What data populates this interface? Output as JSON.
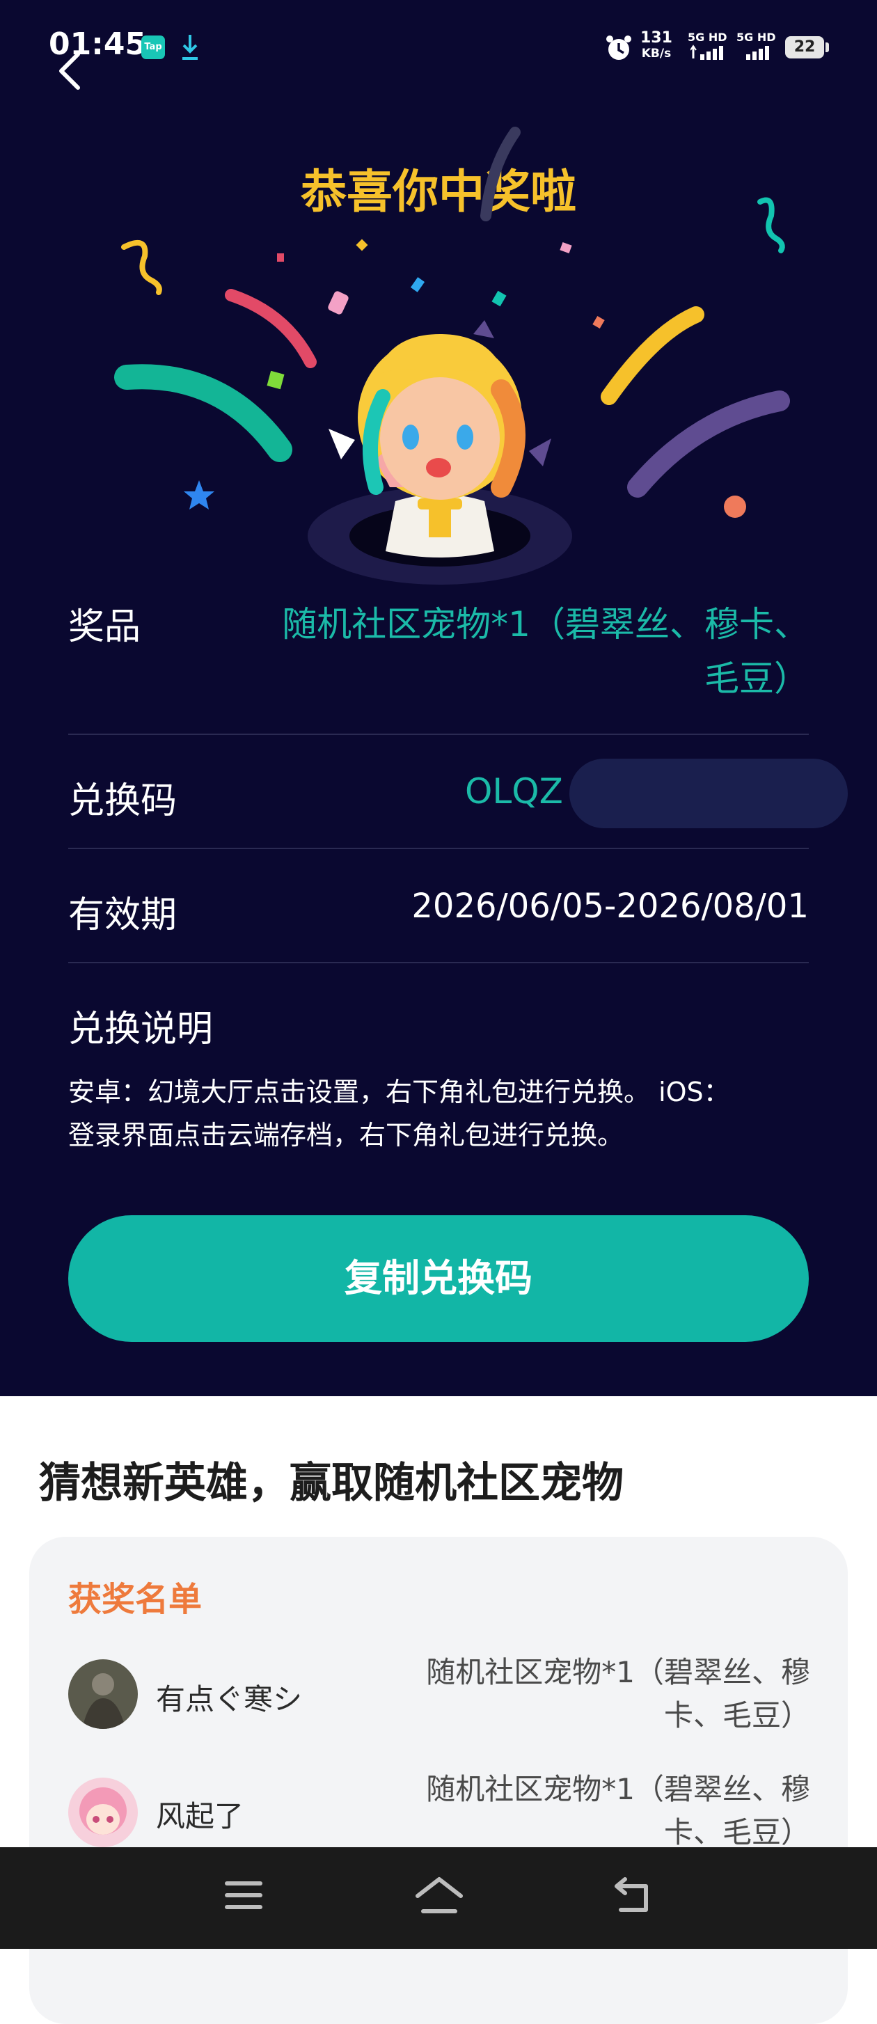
{
  "status_bar": {
    "time": "01:45",
    "tap_label": "Tap",
    "net_speed_value": "131",
    "net_speed_unit": "KB/s",
    "sim1": "5G HD",
    "sim2": "5G HD",
    "battery": "22"
  },
  "header": {
    "title": "恭喜你中奖啦"
  },
  "prize": {
    "label": "奖品",
    "value_line1": "随机社区宠物*1（碧翠丝、穆卡、",
    "value_line2": "毛豆）"
  },
  "code": {
    "label": "兑换码",
    "value": "OLQZ"
  },
  "validity": {
    "label": "有效期",
    "value": "2026/06/05-2026/08/01"
  },
  "instructions": {
    "label": "兑换说明",
    "line1": "安卓：幻境大厅点击设置，右下角礼包进行兑换。 iOS：",
    "line2": "登录界面点击云端存档，右下角礼包进行兑换。"
  },
  "copy_button": "复制兑换码",
  "section": {
    "title": "猜想新英雄，赢取随机社区宠物"
  },
  "winners": {
    "title": "获奖名单",
    "items": [
      {
        "name": "有点ぐ寒シ",
        "prize_line1": "随机社区宠物*1（碧翠丝、穆",
        "prize_line2": "卡、毛豆）"
      },
      {
        "name": "风起了",
        "prize_line1": "随机社区宠物*1（碧翠丝、穆",
        "prize_line2": "卡、毛豆）"
      }
    ]
  },
  "colors": {
    "bg_dark": "#0a0830",
    "accent": "#12b6a6",
    "title_gold": "#f6c12b",
    "winners_orange": "#ee7a3c"
  },
  "icons": [
    "back-arrow-icon",
    "tap-icon",
    "download-icon",
    "alarm-icon",
    "menu-icon",
    "home-icon",
    "return-icon"
  ]
}
